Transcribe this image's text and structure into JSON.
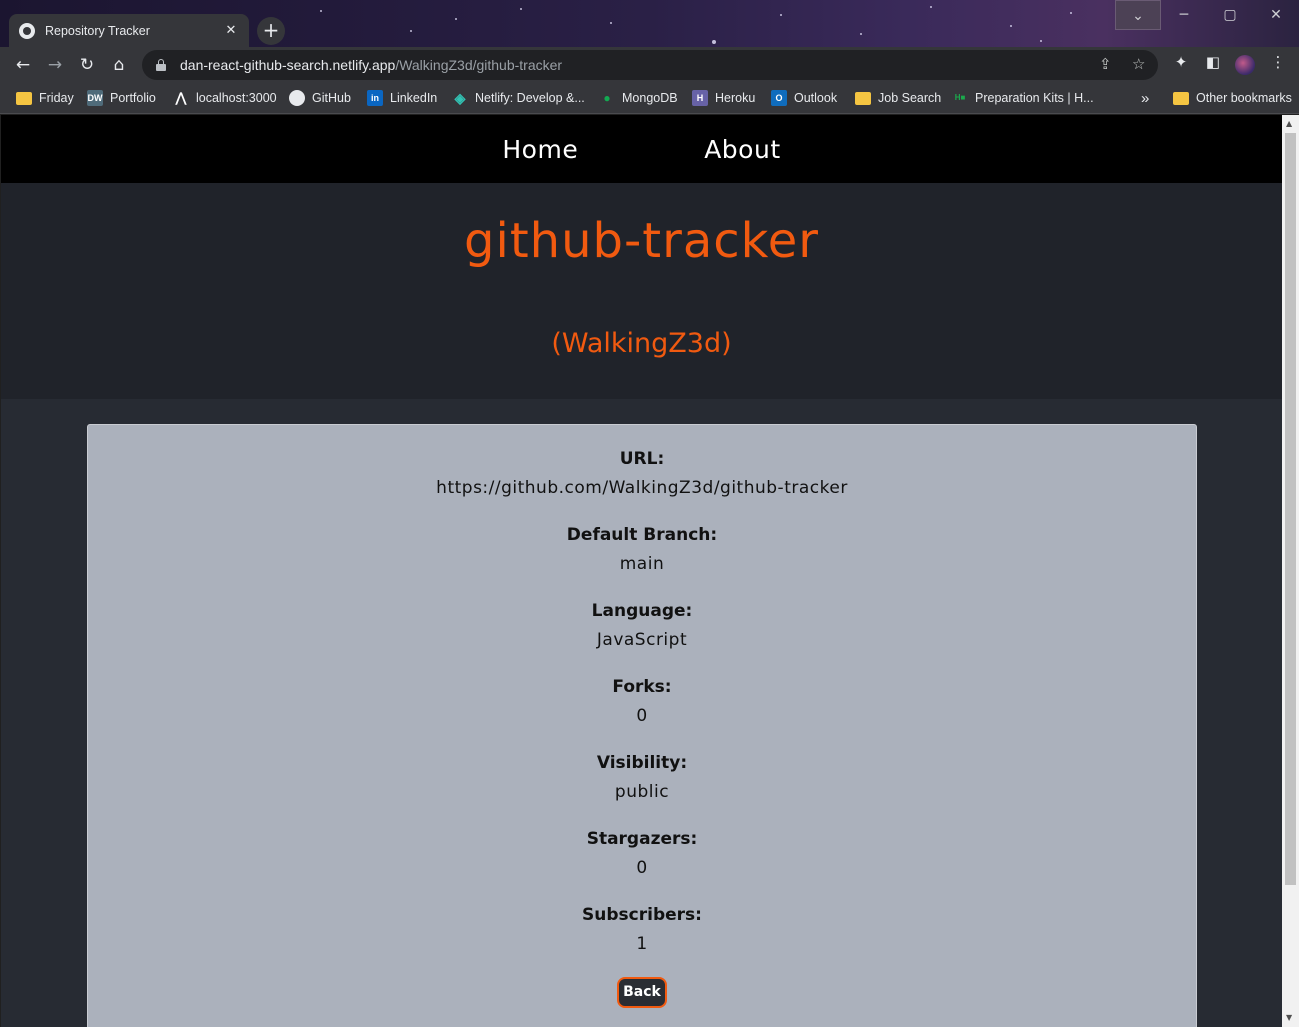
{
  "browser": {
    "tab_title": "Repository Tracker",
    "url_domain": "dan-react-github-search.netlify.app",
    "url_path": "/WalkingZ3d/github-tracker",
    "bookmarks": [
      "Friday",
      "Portfolio",
      "localhost:3000",
      "GitHub",
      "LinkedIn",
      "Netlify: Develop &...",
      "MongoDB",
      "Heroku",
      "Outlook",
      "Job Search",
      "Preparation Kits | H...",
      "Other bookmarks"
    ],
    "overflow_chevron": "»"
  },
  "nav": {
    "home": "Home",
    "about": "About"
  },
  "repo": {
    "name": "github-tracker",
    "owner": "(WalkingZ3d)"
  },
  "details": [
    {
      "label": "URL:",
      "value": "https://github.com/WalkingZ3d/github-tracker"
    },
    {
      "label": "Default Branch:",
      "value": "main"
    },
    {
      "label": "Language:",
      "value": "JavaScript"
    },
    {
      "label": "Forks:",
      "value": "0"
    },
    {
      "label": "Visibility:",
      "value": "public"
    },
    {
      "label": "Stargazers:",
      "value": "0"
    },
    {
      "label": "Subscribers:",
      "value": "1"
    }
  ],
  "back_label": "Back",
  "colors": {
    "accent": "#f15a10",
    "card": "#abb1bc",
    "hero_bg": "#20232a",
    "nav_bg": "#000000"
  }
}
